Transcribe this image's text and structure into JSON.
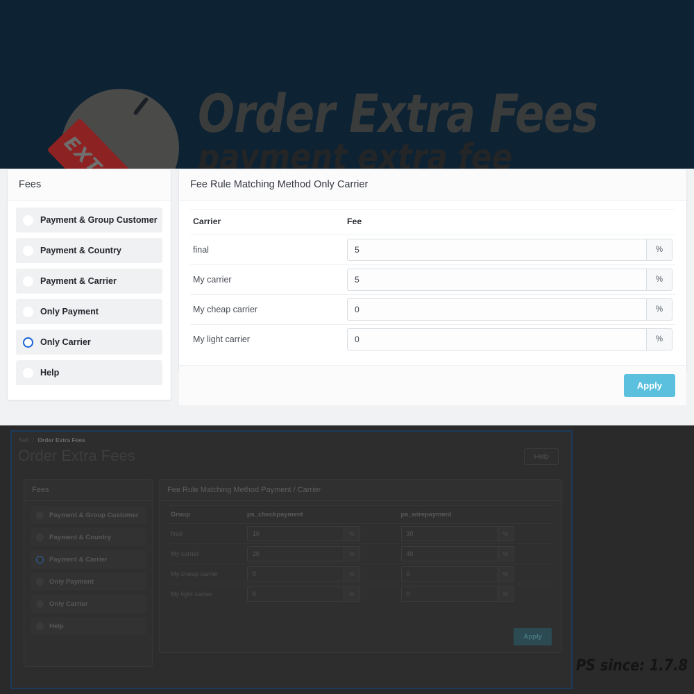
{
  "hero": {
    "title": "Order Extra Fees",
    "subtitle": "payment extra fee",
    "tag_word": "EXTRA"
  },
  "sidebar": {
    "header": "Fees",
    "items": [
      {
        "label": "Payment & Group Customer",
        "selected": false
      },
      {
        "label": "Payment & Country",
        "selected": false
      },
      {
        "label": "Payment & Carrier",
        "selected": false
      },
      {
        "label": "Only Payment",
        "selected": false
      },
      {
        "label": "Only Carrier",
        "selected": true
      },
      {
        "label": "Help",
        "selected": false
      }
    ]
  },
  "main": {
    "header": "Fee Rule Matching Method Only Carrier",
    "columns": [
      "Carrier",
      "Fee"
    ],
    "unit": "%",
    "rows": [
      {
        "carrier": "final",
        "fee": "5"
      },
      {
        "carrier": "My carrier",
        "fee": "5"
      },
      {
        "carrier": "My cheap carrier",
        "fee": "0"
      },
      {
        "carrier": "My light carrier",
        "fee": "0"
      }
    ],
    "apply_label": "Apply",
    "accent_color": "#5bc0de"
  },
  "preview": {
    "breadcrumb_root": "Sell",
    "breadcrumb_sep": "/",
    "breadcrumb_current": "Order Extra Fees",
    "page_title": "Order Extra Fees",
    "help_label": "Help",
    "sidebar_header": "Fees",
    "sidebar_items": [
      {
        "label": "Payment & Group Customer",
        "selected": false
      },
      {
        "label": "Payment & Country",
        "selected": false
      },
      {
        "label": "Payment & Carrier",
        "selected": true
      },
      {
        "label": "Only Payment",
        "selected": false
      },
      {
        "label": "Only Carrier",
        "selected": false
      },
      {
        "label": "Help",
        "selected": false
      }
    ],
    "main_header": "Fee Rule Matching Method Payment / Carrier",
    "columns": [
      "Group",
      "ps_checkpayment",
      "ps_wirepayment"
    ],
    "unit": "%",
    "rows": [
      {
        "group": "final",
        "checkpayment": "10",
        "wirepayment": "30"
      },
      {
        "group": "My carrier",
        "checkpayment": "20",
        "wirepayment": "40"
      },
      {
        "group": "My cheap carrier",
        "checkpayment": "0",
        "wirepayment": "0"
      },
      {
        "group": "My light carrier",
        "checkpayment": "0",
        "wirepayment": "0"
      }
    ],
    "apply_label": "Apply",
    "version_note": "PS since: 1.7.8"
  }
}
